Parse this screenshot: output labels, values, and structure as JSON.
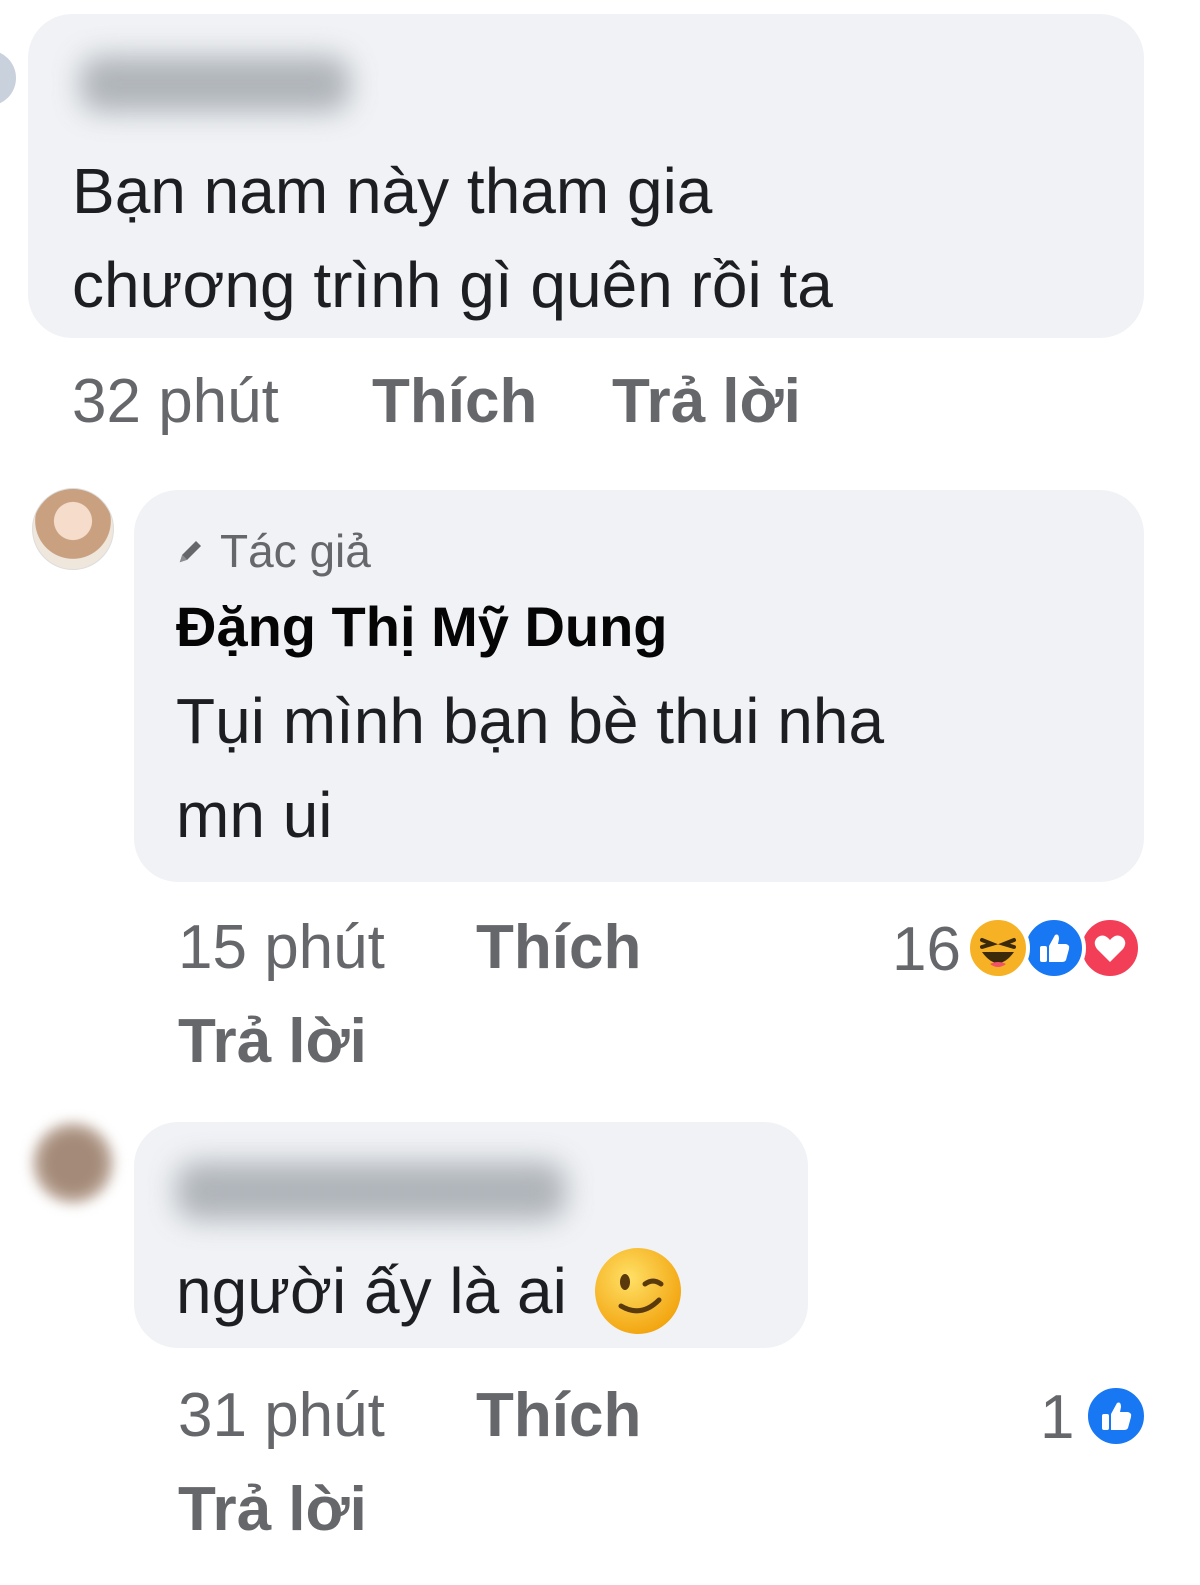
{
  "comments": [
    {
      "text_lines": [
        "Bạn nam này tham gia",
        "chương trình gì quên rồi ta"
      ],
      "time": "32 phút",
      "like": "Thích",
      "reply": "Trả lời"
    },
    {
      "badge": "Tác giả",
      "author": "Đặng Thị Mỹ Dung",
      "text_lines": [
        "Tụi mình bạn bè thui nha",
        "mn ui"
      ],
      "time": "15 phút",
      "like": "Thích",
      "reply": "Trả lời",
      "reaction_count": "16",
      "reactions": [
        "haha-icon",
        "like-icon",
        "love-icon"
      ]
    },
    {
      "text": "người ấy là ai",
      "emoji": "wink-emoji",
      "time": "31 phút",
      "like": "Thích",
      "reply": "Trả lời",
      "reaction_count": "1",
      "reactions": [
        "like-icon"
      ]
    }
  ],
  "colors": {
    "bubble": "#f0f2f5",
    "meta": "#65676b",
    "like_blue": "#1877f2",
    "love_red": "#f33e58",
    "haha_yellow": "#f7b125"
  }
}
